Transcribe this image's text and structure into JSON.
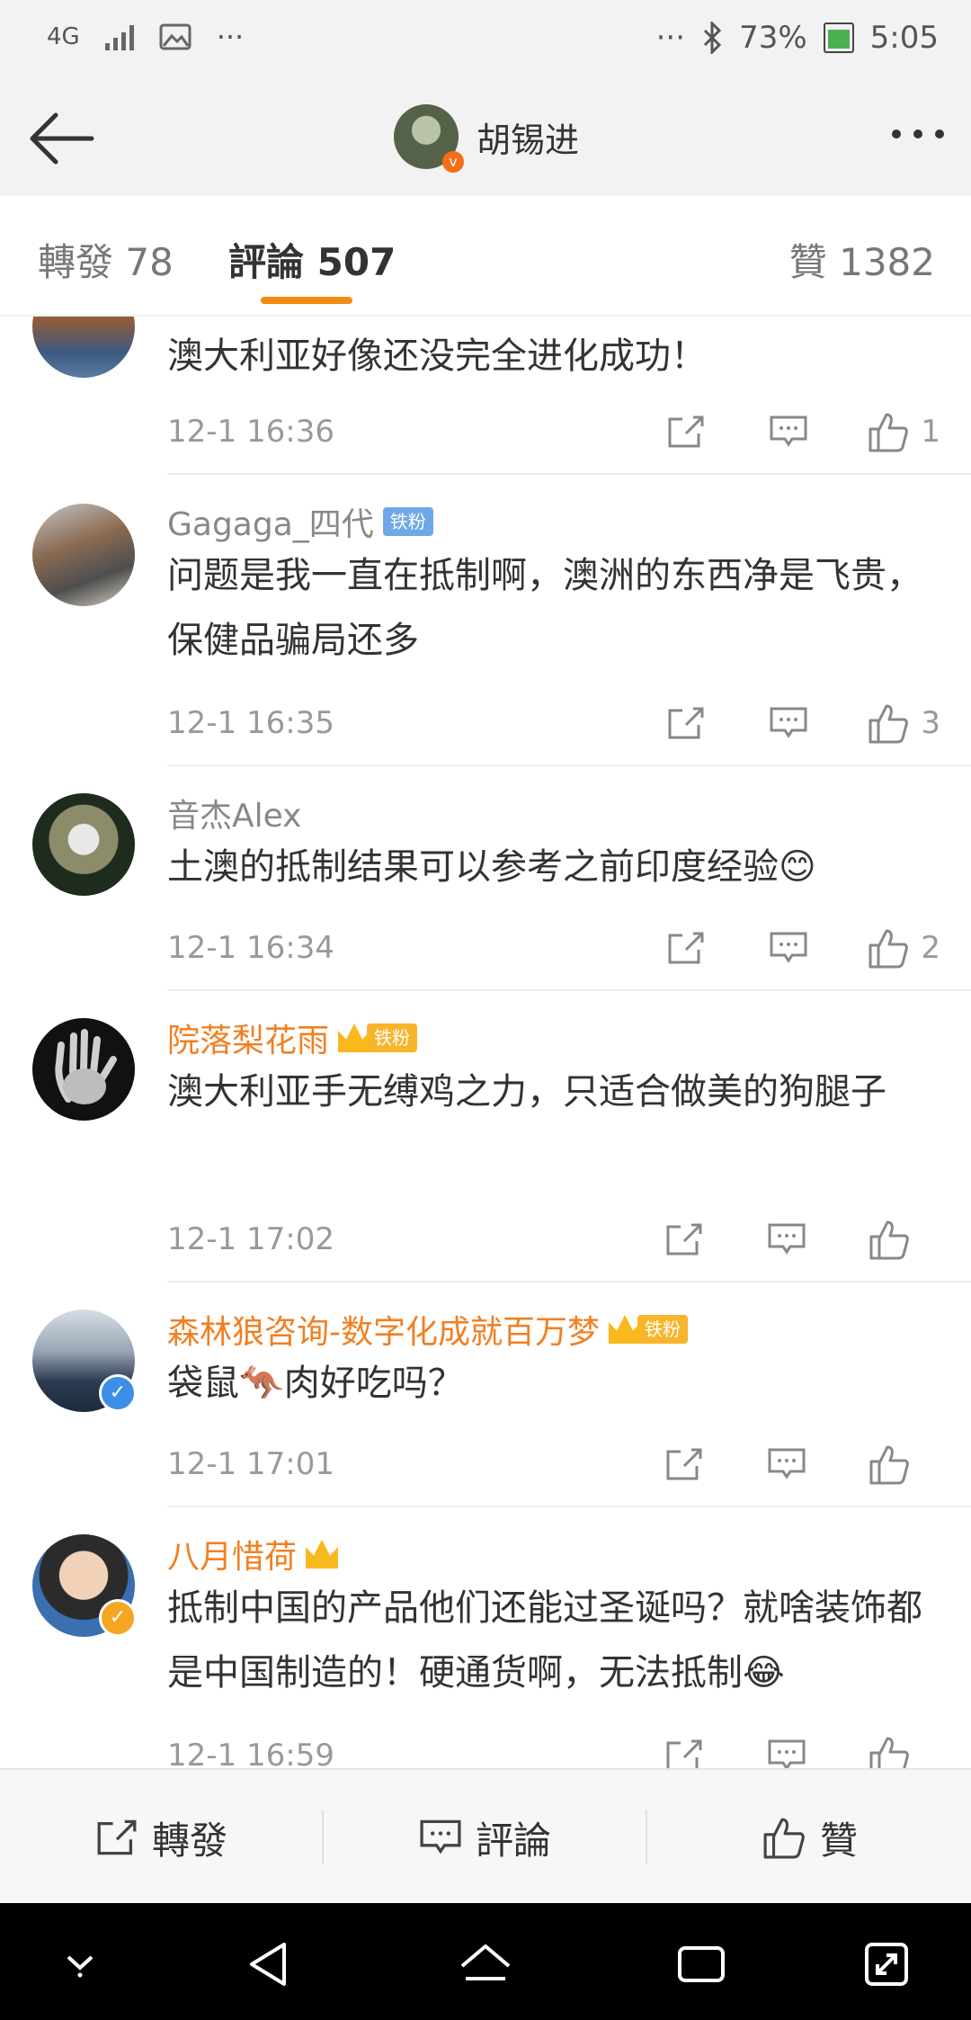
{
  "status_bar": {
    "network": "4G",
    "battery": "73%",
    "time": "5:05",
    "dots": "···"
  },
  "header": {
    "title": "胡锡进"
  },
  "tabs": [
    {
      "label": "轉發 78"
    },
    {
      "label": "評論 507"
    },
    {
      "label": "贊 1382"
    }
  ],
  "comments": [
    {
      "user": "",
      "badge": "",
      "text": "澳大利亚好像还没完全进化成功！",
      "time": "12-1 16:36",
      "likes": "1"
    },
    {
      "user": "Gagaga_四代",
      "badge": "铁粉",
      "text": "问题是我一直在抵制啊，澳洲的东西净是飞贵，保健品骗局还多",
      "time": "12-1 16:35",
      "likes": "3"
    },
    {
      "user": "音杰Alex",
      "badge": "",
      "text": "土澳的抵制结果可以参考之前印度经验😊",
      "time": "12-1 16:34",
      "likes": "2"
    },
    {
      "user": "院落梨花雨",
      "badge": "铁粉",
      "text": "澳大利亚手无缚鸡之力，只适合做美的狗腿子",
      "time": "12-1 17:02",
      "likes": ""
    },
    {
      "user": "森林狼咨询-数字化成就百万梦",
      "badge": "铁粉",
      "text": "袋鼠🦘肉好吃吗？",
      "time": "12-1 17:01",
      "likes": ""
    },
    {
      "user": "八月惜荷",
      "badge": "",
      "text": "抵制中国的产品他们还能过圣诞吗？就啥装饰都是中国制造的！硬通货啊，无法抵制😂",
      "time": "12-1 16:59",
      "likes": ""
    }
  ],
  "bottom_bar": {
    "repost": "轉發",
    "comment": "評論",
    "like": "贊"
  }
}
